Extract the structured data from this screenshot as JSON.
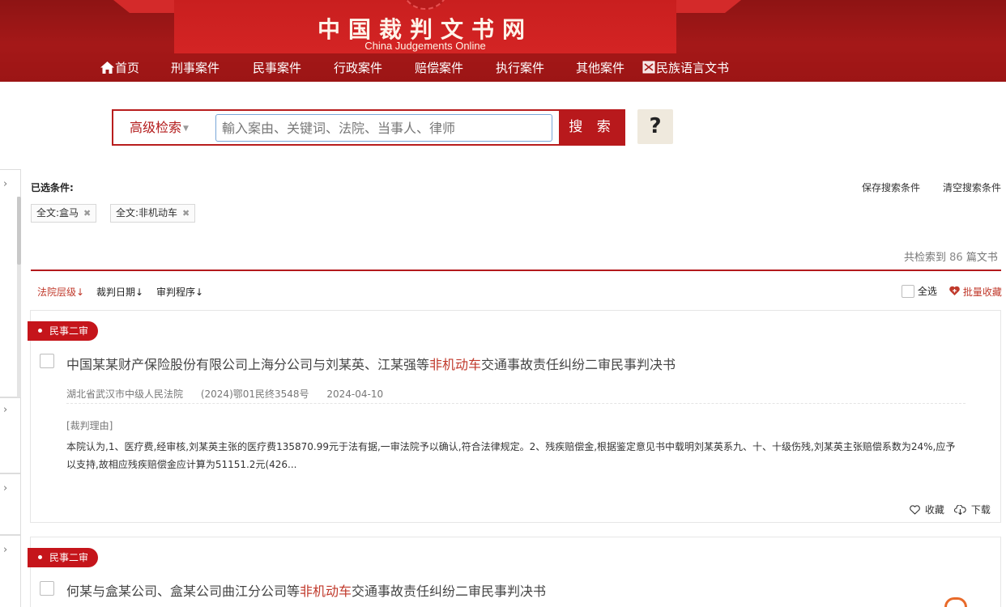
{
  "header": {
    "site_title": "中国裁判文书网",
    "site_subtitle": "China Judgements Online",
    "nav": [
      {
        "label": "首页",
        "icon": "home-icon"
      },
      {
        "label": "刑事案件"
      },
      {
        "label": "民事案件"
      },
      {
        "label": "行政案件"
      },
      {
        "label": "赔偿案件"
      },
      {
        "label": "执行案件"
      },
      {
        "label": "其他案件"
      },
      {
        "label": "民族语言文书",
        "icon": "ethnic-language-icon"
      }
    ]
  },
  "search": {
    "advanced_label": "高级检索",
    "placeholder": "輸入案由、关键词、法院、当事人、律师",
    "button_label": "搜 索",
    "help_label": "?"
  },
  "filters": {
    "selected_label": "已选条件:",
    "save_label": "保存搜索条件",
    "clear_label": "清空搜索条件",
    "tags": [
      {
        "label": "全文:盒马"
      },
      {
        "label": "全文:非机动车"
      }
    ]
  },
  "results": {
    "count_prefix": "共检索到",
    "count": "86",
    "count_suffix": "篇文书",
    "sort": [
      {
        "label": "法院层级",
        "arrow": "↓"
      },
      {
        "label": "裁判日期",
        "arrow": "↓"
      },
      {
        "label": "审判程序",
        "arrow": "↓"
      }
    ],
    "select_all_label": "全选",
    "batch_collect_label": "批量收藏",
    "items": [
      {
        "badge": "民事二审",
        "title_pre": "中国某某财产保险股份有限公司上海分公司与刘某英、江某强等",
        "title_hl": "非机动车",
        "title_post": "交通事故责任纠纷二审民事判决书",
        "court": "湖北省武汉市中级人民法院",
        "case_no": "(2024)鄂01民终3548号",
        "date": "2024-04-10",
        "reason_label": "[裁判理由]",
        "reason": "本院认为,1、医疗费,经审核,刘某英主张的医疗费135870.99元于法有据,一审法院予以确认,符合法律规定。2、残疾赔偿金,根据鉴定意见书中载明刘某英系九、十、十级伤残,刘某英主张赔偿系数为24%,应予以支持,故相应残疾赔偿金应计算为51151.2元(426...",
        "collect_label": "收藏",
        "download_label": "下载"
      },
      {
        "badge": "民事二审",
        "title_pre": "何某与盒某公司、盒某公司曲江分公司等",
        "title_hl": "非机动车",
        "title_post": "交通事故责任纠纷二审民事判决书"
      }
    ]
  },
  "colors": {
    "brand_red": "#b8191c",
    "highlight_red": "#c0392b",
    "help_bg": "#efe9dd"
  }
}
